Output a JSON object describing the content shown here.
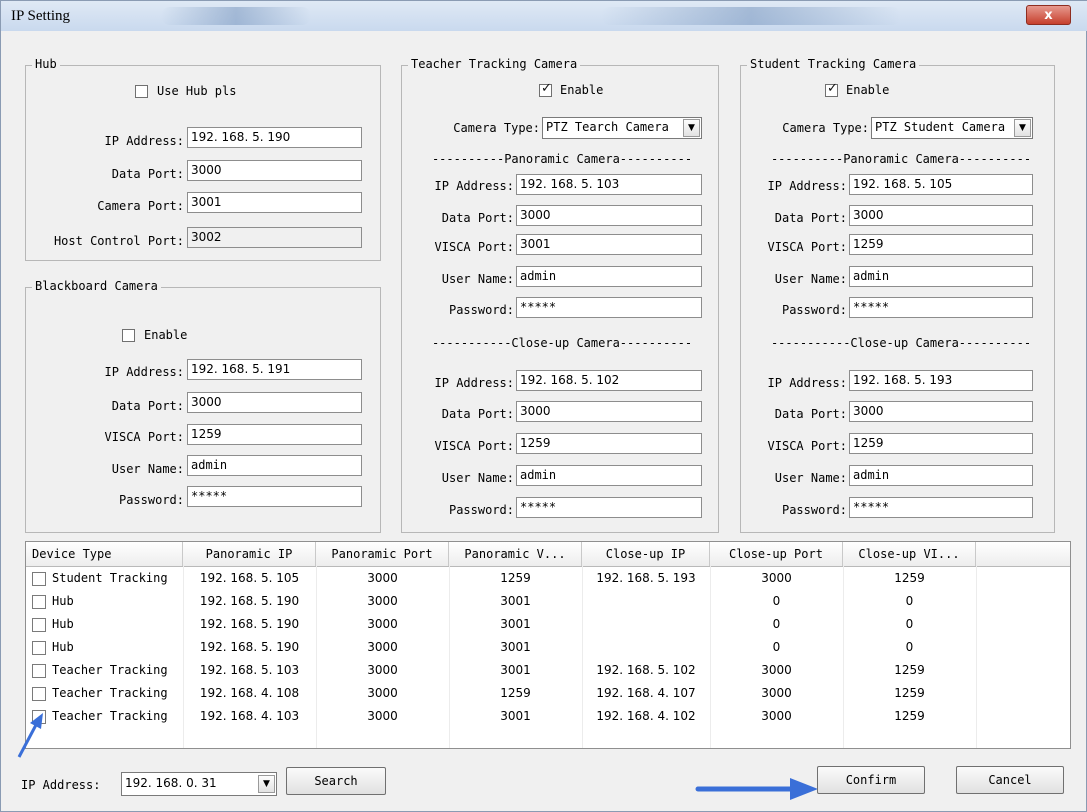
{
  "window": {
    "title": "IP Setting",
    "close_symbol": "x"
  },
  "hub": {
    "group_title": "Hub",
    "use_hub_label": "Use Hub pls",
    "use_hub_checked": false,
    "ip_label": "IP Address:",
    "ip_value": "192. 168. 5. 190",
    "data_port_label": "Data Port:",
    "data_port_value": "3000",
    "camera_port_label": "Camera Port:",
    "camera_port_value": "3001",
    "host_port_label": "Host Control Port:",
    "host_port_value": "3002"
  },
  "blackboard": {
    "group_title": "Blackboard Camera",
    "enable_label": "Enable",
    "enable_checked": false,
    "ip_label": "IP Address:",
    "ip_value": "192. 168. 5. 191",
    "data_port_label": "Data Port:",
    "data_port_value": "3000",
    "visca_label": "VISCA Port:",
    "visca_value": "1259",
    "user_label": "User Name:",
    "user_value": "admin",
    "password_label": "Password:",
    "password_value": "*****"
  },
  "teacher": {
    "group_title": "Teacher Tracking Camera",
    "enable_label": "Enable",
    "enable_checked": true,
    "type_label": "Camera Type:",
    "type_value": "PTZ Tearch Camera",
    "panoramic_divider": "----------Panoramic Camera----------",
    "pan_ip_label": "IP Address:",
    "pan_ip_value": "192. 168. 5. 103",
    "pan_data_label": "Data Port:",
    "pan_data_value": "3000",
    "pan_visca_label": "VISCA Port:",
    "pan_visca_value": "3001",
    "pan_user_label": "User Name:",
    "pan_user_value": "admin",
    "pan_pass_label": "Password:",
    "pan_pass_value": "*****",
    "closeup_divider": "-----------Close-up Camera----------",
    "cu_ip_label": "IP Address:",
    "cu_ip_value": "192. 168. 5. 102",
    "cu_data_label": "Data Port:",
    "cu_data_value": "3000",
    "cu_visca_label": "VISCA Port:",
    "cu_visca_value": "1259",
    "cu_user_label": "User Name:",
    "cu_user_value": "admin",
    "cu_pass_label": "Password:",
    "cu_pass_value": "*****"
  },
  "student": {
    "group_title": "Student Tracking Camera",
    "enable_label": "Enable",
    "enable_checked": true,
    "type_label": "Camera Type:",
    "type_value": "PTZ Student Camera",
    "panoramic_divider": "----------Panoramic Camera----------",
    "pan_ip_label": "IP Address:",
    "pan_ip_value": "192. 168. 5. 105",
    "pan_data_label": "Data Port:",
    "pan_data_value": "3000",
    "pan_visca_label": "VISCA Port:",
    "pan_visca_value": "1259",
    "pan_user_label": "User Name:",
    "pan_user_value": "admin",
    "pan_pass_label": "Password:",
    "pan_pass_value": "*****",
    "closeup_divider": "-----------Close-up Camera----------",
    "cu_ip_label": "IP Address:",
    "cu_ip_value": "192. 168. 5. 193",
    "cu_data_label": "Data Port:",
    "cu_data_value": "3000",
    "cu_visca_label": "VISCA Port:",
    "cu_visca_value": "1259",
    "cu_user_label": "User Name:",
    "cu_user_value": "admin",
    "cu_pass_label": "Password:",
    "cu_pass_value": "*****"
  },
  "table": {
    "headers": [
      "Device Type",
      "Panoramic IP",
      "Panoramic Port",
      "Panoramic V...",
      "Close-up IP",
      "Close-up Port",
      "Close-up VI..."
    ],
    "rows": [
      {
        "device": "Student Tracking",
        "pan_ip": "192. 168. 5. 105",
        "pan_port": "3000",
        "pan_visca": "1259",
        "cu_ip": "192. 168. 5. 193",
        "cu_port": "3000",
        "cu_visca": "1259"
      },
      {
        "device": "Hub",
        "pan_ip": "192. 168. 5. 190",
        "pan_port": "3000",
        "pan_visca": "3001",
        "cu_ip": "",
        "cu_port": "0",
        "cu_visca": "0"
      },
      {
        "device": "Hub",
        "pan_ip": "192. 168. 5. 190",
        "pan_port": "3000",
        "pan_visca": "3001",
        "cu_ip": "",
        "cu_port": "0",
        "cu_visca": "0"
      },
      {
        "device": "Hub",
        "pan_ip": "192. 168. 5. 190",
        "pan_port": "3000",
        "pan_visca": "3001",
        "cu_ip": "",
        "cu_port": "0",
        "cu_visca": "0"
      },
      {
        "device": "Teacher Tracking",
        "pan_ip": "192. 168. 5. 103",
        "pan_port": "3000",
        "pan_visca": "3001",
        "cu_ip": "192. 168. 5. 102",
        "cu_port": "3000",
        "cu_visca": "1259"
      },
      {
        "device": "Teacher Tracking",
        "pan_ip": "192. 168. 4. 108",
        "pan_port": "3000",
        "pan_visca": "1259",
        "cu_ip": "192. 168. 4. 107",
        "cu_port": "3000",
        "cu_visca": "1259"
      },
      {
        "device": "Teacher Tracking",
        "pan_ip": "192. 168. 4. 103",
        "pan_port": "3000",
        "pan_visca": "3001",
        "cu_ip": "192. 168. 4. 102",
        "cu_port": "3000",
        "cu_visca": "1259"
      }
    ]
  },
  "footer": {
    "ip_label": "IP Address:",
    "ip_value": "192. 168. 0. 31",
    "search_label": "Search",
    "confirm_label": "Confirm",
    "cancel_label": "Cancel"
  },
  "colors": {
    "annotation_arrow": "#3a6fd8",
    "close_button": "#c6402d"
  }
}
